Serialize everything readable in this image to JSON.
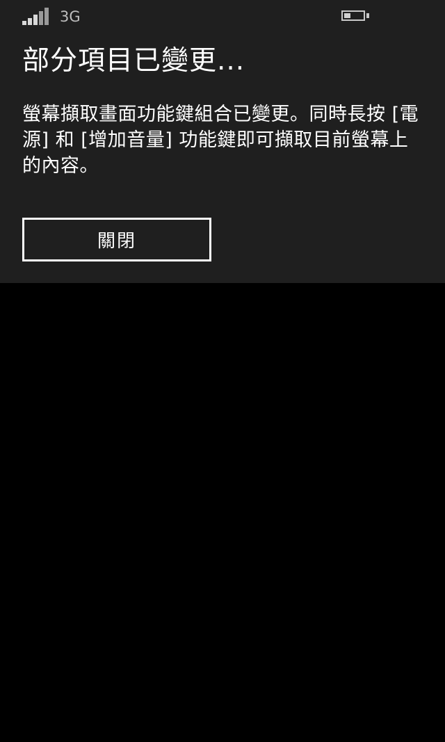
{
  "status_bar": {
    "signal_icon": "signal-strength-icon",
    "signal_level": 0.6,
    "network": "3G",
    "battery_icon": "battery-icon",
    "battery_level": 0.35
  },
  "dialog": {
    "title": "部分項目已變更...",
    "message": "螢幕擷取畫面功能鍵組合已變更。同時長按 [電源] 和 [增加音量] 功能鍵即可擷取目前螢幕上的內容。",
    "close_label": "關閉"
  },
  "colors": {
    "dialog_background": "#1f1f1f",
    "screen_background": "#000000",
    "text": "#ffffff"
  }
}
